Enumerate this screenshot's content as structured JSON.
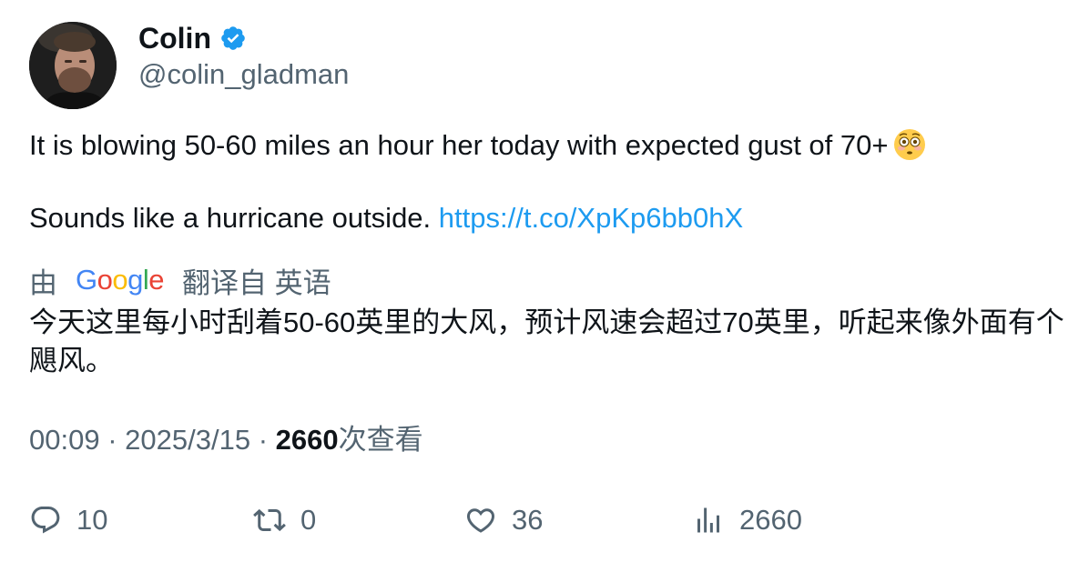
{
  "user": {
    "display_name": "Colin",
    "handle": "@colin_gladman",
    "verified_icon": "verified-badge-icon"
  },
  "tweet": {
    "line1": "It is blowing 50-60 miles an hour her today with expected gust of 70+",
    "emoji": "flushed-face-emoji",
    "line2_text": "Sounds like a hurricane outside.",
    "link": "https://t.co/XpKp6bb0hX"
  },
  "translation": {
    "prefix": "由",
    "provider": "Google",
    "suffix": "翻译自 英语",
    "text": "今天这里每小时刮着50-60英里的大风，预计风速会超过70英里，听起来像外面有个飓风。"
  },
  "meta": {
    "time": "00:09",
    "date": "2025/3/15",
    "views_count": "2660",
    "views_label": "次查看",
    "separator": "·"
  },
  "actions": {
    "replies": "10",
    "retweets": "0",
    "likes": "36",
    "views": "2660"
  },
  "colors": {
    "link": "#1d9bf0",
    "secondary_text": "#536471",
    "primary_text": "#0f1419",
    "google_blue": "#4285f4",
    "google_red": "#ea4335",
    "google_yellow": "#fbbc05",
    "google_green": "#34a853"
  }
}
